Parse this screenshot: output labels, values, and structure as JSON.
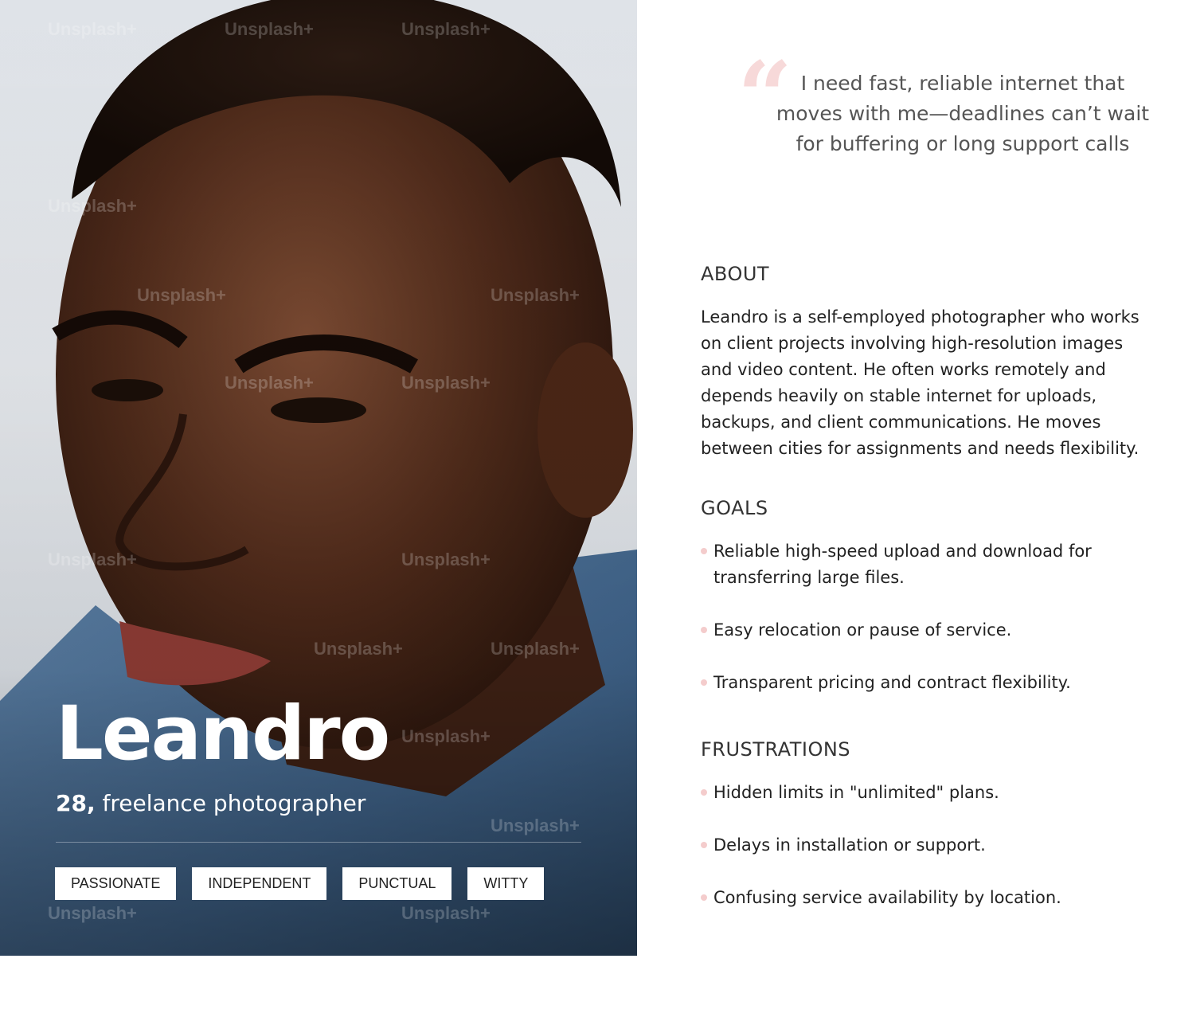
{
  "persona": {
    "name": "Leandro",
    "age": "28,",
    "role": "freelance photographer",
    "traits": [
      "PASSIONATE",
      "INDEPENDENT",
      "PUNCTUAL",
      "WITTY"
    ]
  },
  "photo": {
    "watermark": "Unsplash+"
  },
  "quote": {
    "text": "I need fast, reliable internet that moves with me—deadlines can’t wait for buffering or long support calls"
  },
  "about": {
    "title": "ABOUT",
    "text": "Leandro is a self-employed photographer who works on client projects involving high-resolution images and video content. He often works remotely and depends heavily on stable internet for uploads, backups, and client communications. He moves between cities for assignments and needs flexibility."
  },
  "goals": {
    "title": "GOALS",
    "items": [
      "Reliable high-speed upload and download for transferring large files.",
      "Easy relocation or pause of service.",
      "Transparent pricing and contract flexibility."
    ]
  },
  "frustrations": {
    "title": "FRUSTRATIONS",
    "items": [
      "Hidden limits in \"unlimited\" plans.",
      "Delays in installation or support.",
      "Confusing service availability by location."
    ]
  },
  "colors": {
    "accent_pink": "#f4cccc",
    "text_dark": "#222222",
    "quote_gray": "#555555"
  }
}
